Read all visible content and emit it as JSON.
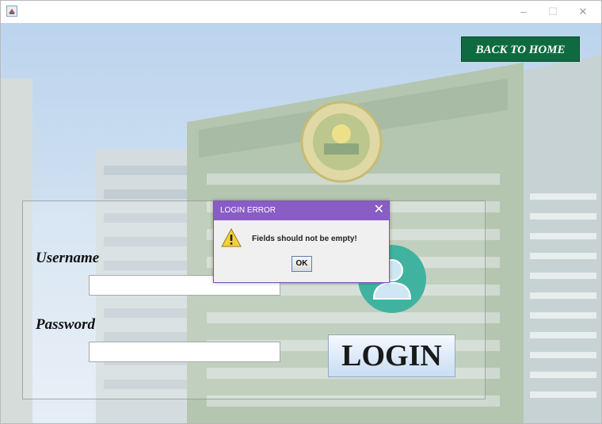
{
  "window": {
    "title": "",
    "controls": {
      "minimize": "–",
      "maximize": "☐",
      "close": "✕"
    }
  },
  "header": {
    "back_label": "BACK TO HOME"
  },
  "form": {
    "username_label": "Username",
    "username_value": "",
    "password_label": "Password",
    "password_value": "",
    "login_label": "LOGIN"
  },
  "dialog": {
    "title": "LOGIN ERROR",
    "close": "✕",
    "message": "Fields should not be empty!",
    "ok_label": "OK"
  },
  "colors": {
    "back_button": "#0f6b3f",
    "dialog_title": "#8a5cc5",
    "avatar": "#3fb3a0"
  },
  "icons": [
    "java-app-icon",
    "user-avatar-icon",
    "warning-icon",
    "building-background-image",
    "city-seal-logo"
  ]
}
